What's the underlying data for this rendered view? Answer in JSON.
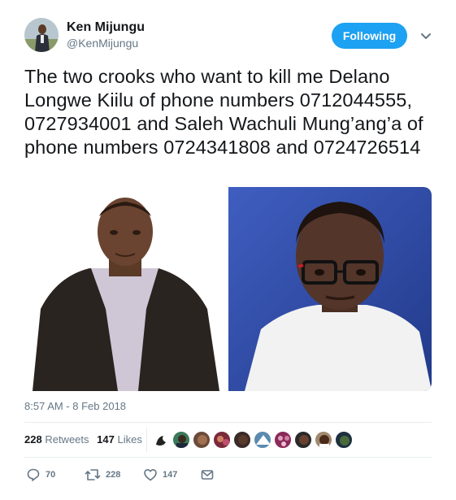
{
  "user": {
    "display_name": "Ken Mijungu",
    "handle": "@KenMijungu",
    "follow_label": "Following"
  },
  "tweet": {
    "text": "The two crooks who want to kill me Delano Longwe Kiilu of phone numbers 0712044555, 0727934001 and Saleh  Wachuli Mung’ang’a of phone numbers 0724341808 and 0724726514",
    "timestamp": "8:57 AM - 8 Feb 2018"
  },
  "stats": {
    "retweets_count": "228",
    "retweets_label": "Retweets",
    "likes_count": "147",
    "likes_label": "Likes"
  },
  "actions": {
    "reply_count": "70",
    "retweet_count": "228",
    "like_count": "147"
  },
  "icons": [
    "chevron-down-icon",
    "reply-icon",
    "retweet-icon",
    "heart-icon",
    "message-icon"
  ],
  "colors": {
    "accent": "#1da1f2",
    "text": "#14171a",
    "muted": "#657786",
    "divider": "#e6ecf0"
  }
}
